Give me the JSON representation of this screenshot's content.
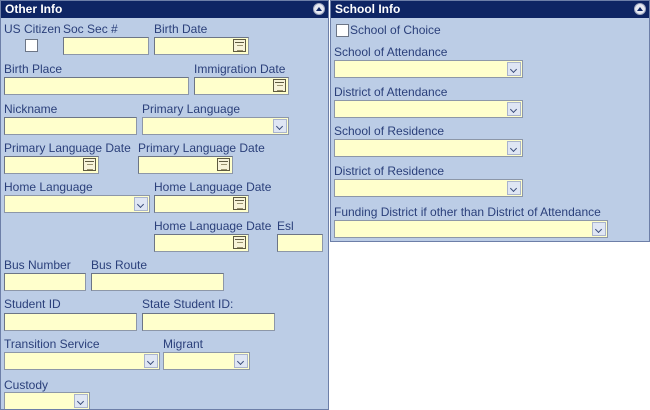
{
  "other_info": {
    "title": "Other Info",
    "labels": {
      "us_citizen": "US Citizen",
      "soc_sec": "Soc Sec #",
      "birth_date": "Birth Date",
      "birth_place": "Birth Place",
      "immigration_date": "Immigration Date",
      "nickname": "Nickname",
      "primary_language": "Primary Language",
      "primary_language_date_1": "Primary Language Date",
      "primary_language_date_2": "Primary Language Date",
      "home_language": "Home Language",
      "home_language_date_1": "Home Language Date",
      "home_language_date_2": "Home Language Date",
      "esl": "Esl",
      "bus_number": "Bus Number",
      "bus_route": "Bus Route",
      "student_id": "Student ID",
      "state_student_id": "State Student ID:",
      "transition_service": "Transition Service",
      "migrant": "Migrant",
      "custody": "Custody"
    }
  },
  "school_info": {
    "title": "School Info",
    "labels": {
      "school_of_choice": "School of Choice",
      "school_of_attendance": "School of Attendance",
      "district_of_attendance": "District of Attendance",
      "school_of_residence": "School of Residence",
      "district_of_residence": "District of Residence",
      "funding_district": "Funding District if other than District of Attendance"
    }
  },
  "colors": {
    "header": "#0e2564",
    "panel": "#bccde6",
    "input": "#ffffcc",
    "label": "#2a3f7a"
  }
}
